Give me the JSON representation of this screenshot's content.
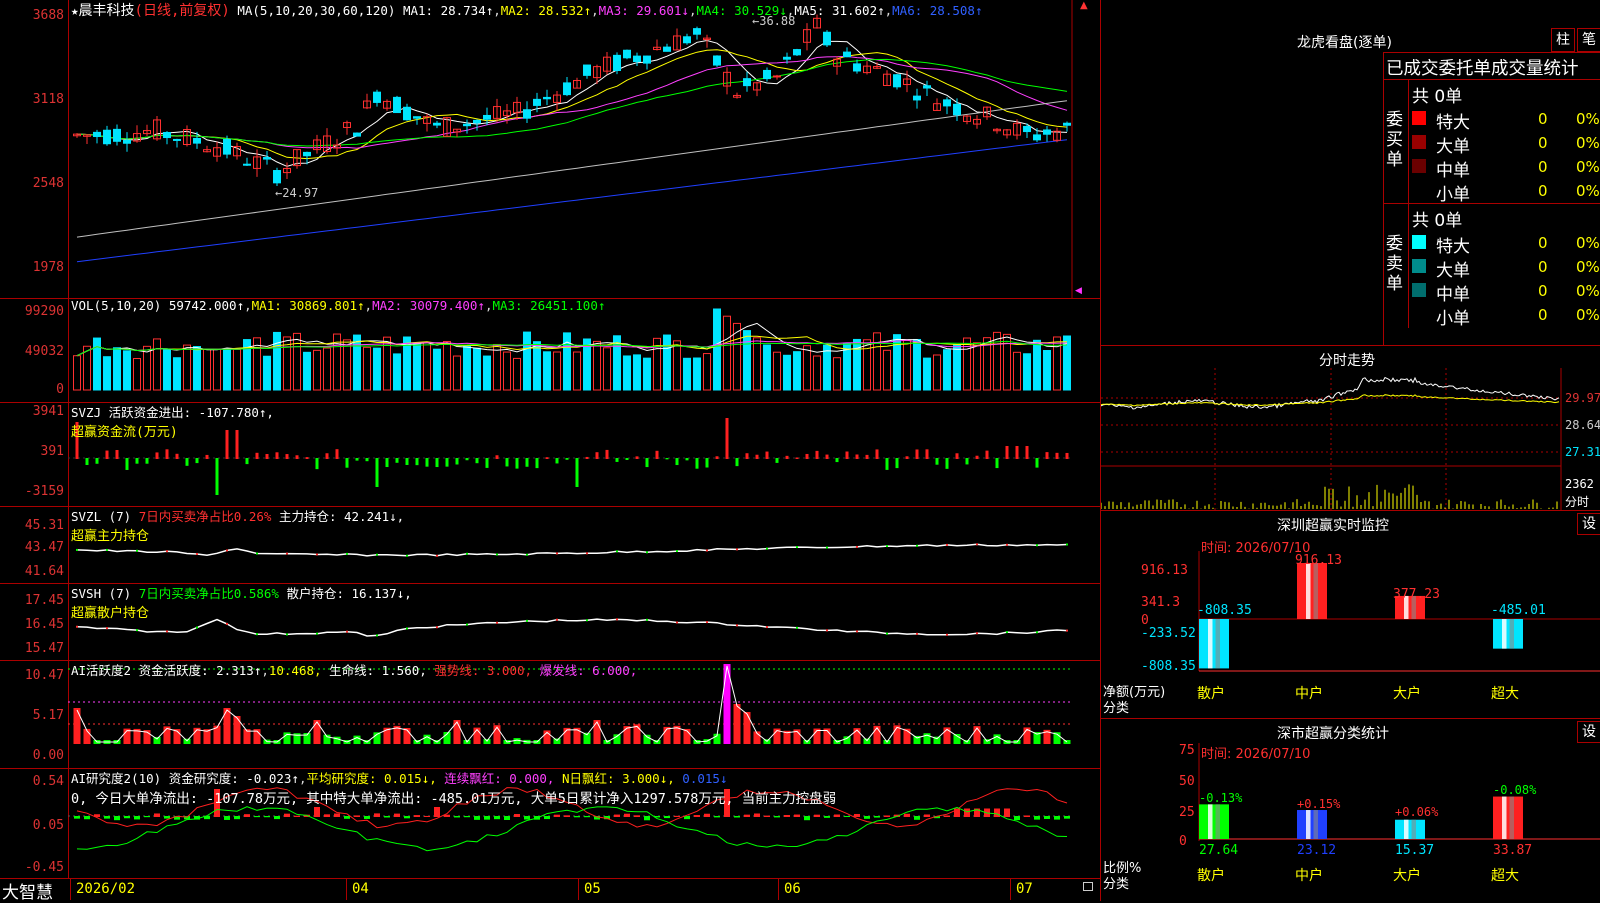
{
  "kline": {
    "header": {
      "star": "★",
      "name": "晨丰科技",
      "mode": "(日线,前复权)",
      "ma_params": "MA(5,10,20,30,60,120)",
      "ma1": "MA1: 28.734↑",
      "ma2": "MA2: 28.532↑",
      "ma3": "MA3: 29.601↓",
      "ma4": "MA4: 30.529↓",
      "ma5": "MA5: 31.602↑",
      "ma6": "MA6: 28.508↑"
    },
    "yticks": [
      "3688",
      "3118",
      "2548",
      "1978"
    ],
    "high_label": "36.88",
    "low_label": "24.97",
    "marker_top": "▲",
    "marker_bottom": "▼"
  },
  "vol": {
    "header": {
      "title": "VOL(5,10,20)",
      "val": "59742.000↑",
      "ma1": "MA1: 30869.801↑",
      "ma2": "MA2: 30079.400↑",
      "ma3": "MA3: 26451.100↑"
    },
    "yticks": [
      "99290",
      "49032",
      "0"
    ]
  },
  "svzj": {
    "header": {
      "title": "SVZJ  活跃资金进出: -107.780↑,",
      "sub": "超赢资金流(万元)"
    },
    "yticks": [
      "3941",
      "391",
      "-3159"
    ]
  },
  "svzl": {
    "header": {
      "title": "SVZL (7)",
      "ratio": "7日内买卖净占比0.26%",
      "hold": "主力持仓: 42.241↓,",
      "sub": "超赢主力持仓"
    },
    "yticks": [
      "45.31",
      "43.47",
      "41.64"
    ]
  },
  "svsh": {
    "header": {
      "title": "SVSH (7)",
      "ratio": "7日内买卖净占比0.586%",
      "hold": "散户持仓: 16.137↓,",
      "sub": "超赢散户持仓"
    },
    "yticks": [
      "17.45",
      "16.45",
      "15.47"
    ]
  },
  "ai1": {
    "header": {
      "title": "AI活跃度2",
      "active": "资金活跃度: 2.313↑",
      "v2": "10.468,",
      "life": "生命线: 1.560,",
      "strong": "强势线: 3.000,",
      "burst": "爆发线: 6.000,"
    },
    "yticks": [
      "10.47",
      "5.17",
      "0.00"
    ]
  },
  "ai2": {
    "header": {
      "title": "AI研究度2(10)",
      "research": "资金研究度: -0.023↑",
      "avg": "平均研究度: 0.015↓,",
      "cont": "连续飘红: 0.000,",
      "nday": "N日飘红: 3.000↓,",
      "last": "0.015↓"
    },
    "summary": "0, 今日大单净流出: -107.78万元, 其中特大单净流出: -485.01万元, 大单5日累计净入1297.578万元, 当前主力控盘弱",
    "yticks": [
      "0.54",
      "0.05",
      "-0.45"
    ]
  },
  "xaxis": {
    "logo": "大智慧",
    "labels": [
      "2026/02",
      "04",
      "05",
      "06",
      "07"
    ]
  },
  "right": {
    "title": "龙虎看盘(逐单)",
    "btn_col": "柱",
    "btn_pen": "笔",
    "stat_title": "已成交委托单成交量统计",
    "buy": {
      "side": "委买单",
      "total": "共 0单",
      "rows": [
        {
          "name": "特大",
          "val": "0",
          "pct": "0%",
          "color": "#ff0000"
        },
        {
          "name": "大单",
          "val": "0",
          "pct": "0%",
          "color": "#990000"
        },
        {
          "name": "中单",
          "val": "0",
          "pct": "0%",
          "color": "#6a0000"
        },
        {
          "name": "小单",
          "val": "0",
          "pct": "0%",
          "color": ""
        }
      ]
    },
    "sell": {
      "side": "委卖单",
      "total": "共 0单",
      "rows": [
        {
          "name": "特大",
          "val": "0",
          "pct": "0%",
          "color": "#00ffff"
        },
        {
          "name": "大单",
          "val": "0",
          "pct": "0%",
          "color": "#008c8c"
        },
        {
          "name": "中单",
          "val": "0",
          "pct": "0%",
          "color": "#006e6e"
        },
        {
          "name": "小单",
          "val": "0",
          "pct": "0%",
          "color": ""
        }
      ]
    },
    "intraday": {
      "title": "分时走势",
      "yticks": [
        "29.97",
        "28.64",
        "27.31"
      ],
      "vol_tick": "2362",
      "vol_label": "分时"
    },
    "monitor": {
      "title": "深圳超赢实时监控",
      "btn": "设",
      "time": "时间: 2026/07/10",
      "yticks": [
        "916.13",
        "341.3",
        "0",
        "-233.52",
        "-808.35"
      ],
      "ylabel": "净额(万元)",
      "xlabel": "分类",
      "cats": [
        "散户",
        "中户",
        "大户",
        "超大"
      ],
      "values": [
        "-808.35",
        "916.13",
        "377.23",
        "-485.01"
      ]
    },
    "classify": {
      "title": "深市超赢分类统计",
      "btn": "设",
      "time": "时间: 2026/07/10",
      "yticks": [
        "75",
        "50",
        "25",
        "0"
      ],
      "ylabel": "比例%",
      "xlabel": "分类",
      "cats": [
        "散户",
        "中户",
        "大户",
        "超大"
      ],
      "values": [
        "27.64",
        "23.12",
        "15.37",
        "33.87"
      ],
      "changes": [
        "-0.13%",
        "+0.15%",
        "+0.06%",
        "-0.08%"
      ]
    }
  },
  "chart_data": [
    {
      "type": "candlestick",
      "title": "晨丰科技 (日线,前复权)",
      "y_ticks": [
        1978,
        2548,
        3118,
        3688
      ],
      "high": 36.88,
      "low": 24.97,
      "series": [
        {
          "name": "MA1",
          "value": 28.734
        },
        {
          "name": "MA2",
          "value": 28.532
        },
        {
          "name": "MA3",
          "value": 29.601
        },
        {
          "name": "MA4",
          "value": 30.529
        },
        {
          "name": "MA5",
          "value": 31.602
        },
        {
          "name": "MA6",
          "value": 28.508
        }
      ]
    },
    {
      "type": "bar",
      "title": "VOL(5,10,20)",
      "last": 59742.0,
      "ylim": [
        0,
        99290
      ],
      "series": [
        {
          "name": "MA1",
          "value": 30869.801
        },
        {
          "name": "MA2",
          "value": 30079.4
        },
        {
          "name": "MA3",
          "value": 26451.1
        }
      ]
    },
    {
      "type": "bar",
      "title": "超赢资金流(万元)",
      "ylim": [
        -3159,
        3941
      ],
      "last": -107.78
    },
    {
      "type": "line",
      "title": "超赢主力持仓",
      "ylim": [
        41.64,
        45.31
      ],
      "last": 42.241
    },
    {
      "type": "line",
      "title": "超赢散户持仓",
      "ylim": [
        15.47,
        17.45
      ],
      "last": 16.137
    },
    {
      "type": "bar",
      "title": "AI活跃度2",
      "ylim": [
        0,
        10.47
      ],
      "series": [
        {
          "name": "资金活跃度",
          "value": 2.313
        },
        {
          "name": "生命线",
          "value": 1.56
        },
        {
          "name": "强势线",
          "value": 3.0
        },
        {
          "name": "爆发线",
          "value": 6.0
        }
      ]
    },
    {
      "type": "bar",
      "title": "AI研究度2(10)",
      "ylim": [
        -0.45,
        0.54
      ],
      "series": [
        {
          "name": "资金研究度",
          "value": -0.023
        },
        {
          "name": "平均研究度",
          "value": 0.015
        }
      ]
    },
    {
      "type": "bar",
      "title": "深圳超赢实时监控",
      "categories": [
        "散户",
        "中户",
        "大户",
        "超大"
      ],
      "values": [
        -808.35,
        916.13,
        377.23,
        -485.01
      ],
      "ylim": [
        -808.35,
        916.13
      ],
      "ylabel": "净额(万元)",
      "xlabel": "分类"
    },
    {
      "type": "bar",
      "title": "深市超赢分类统计",
      "categories": [
        "散户",
        "中户",
        "大户",
        "超大"
      ],
      "values": [
        27.64,
        23.12,
        15.37,
        33.87
      ],
      "ylim": [
        0,
        75
      ],
      "ylabel": "比例%",
      "xlabel": "分类"
    }
  ]
}
